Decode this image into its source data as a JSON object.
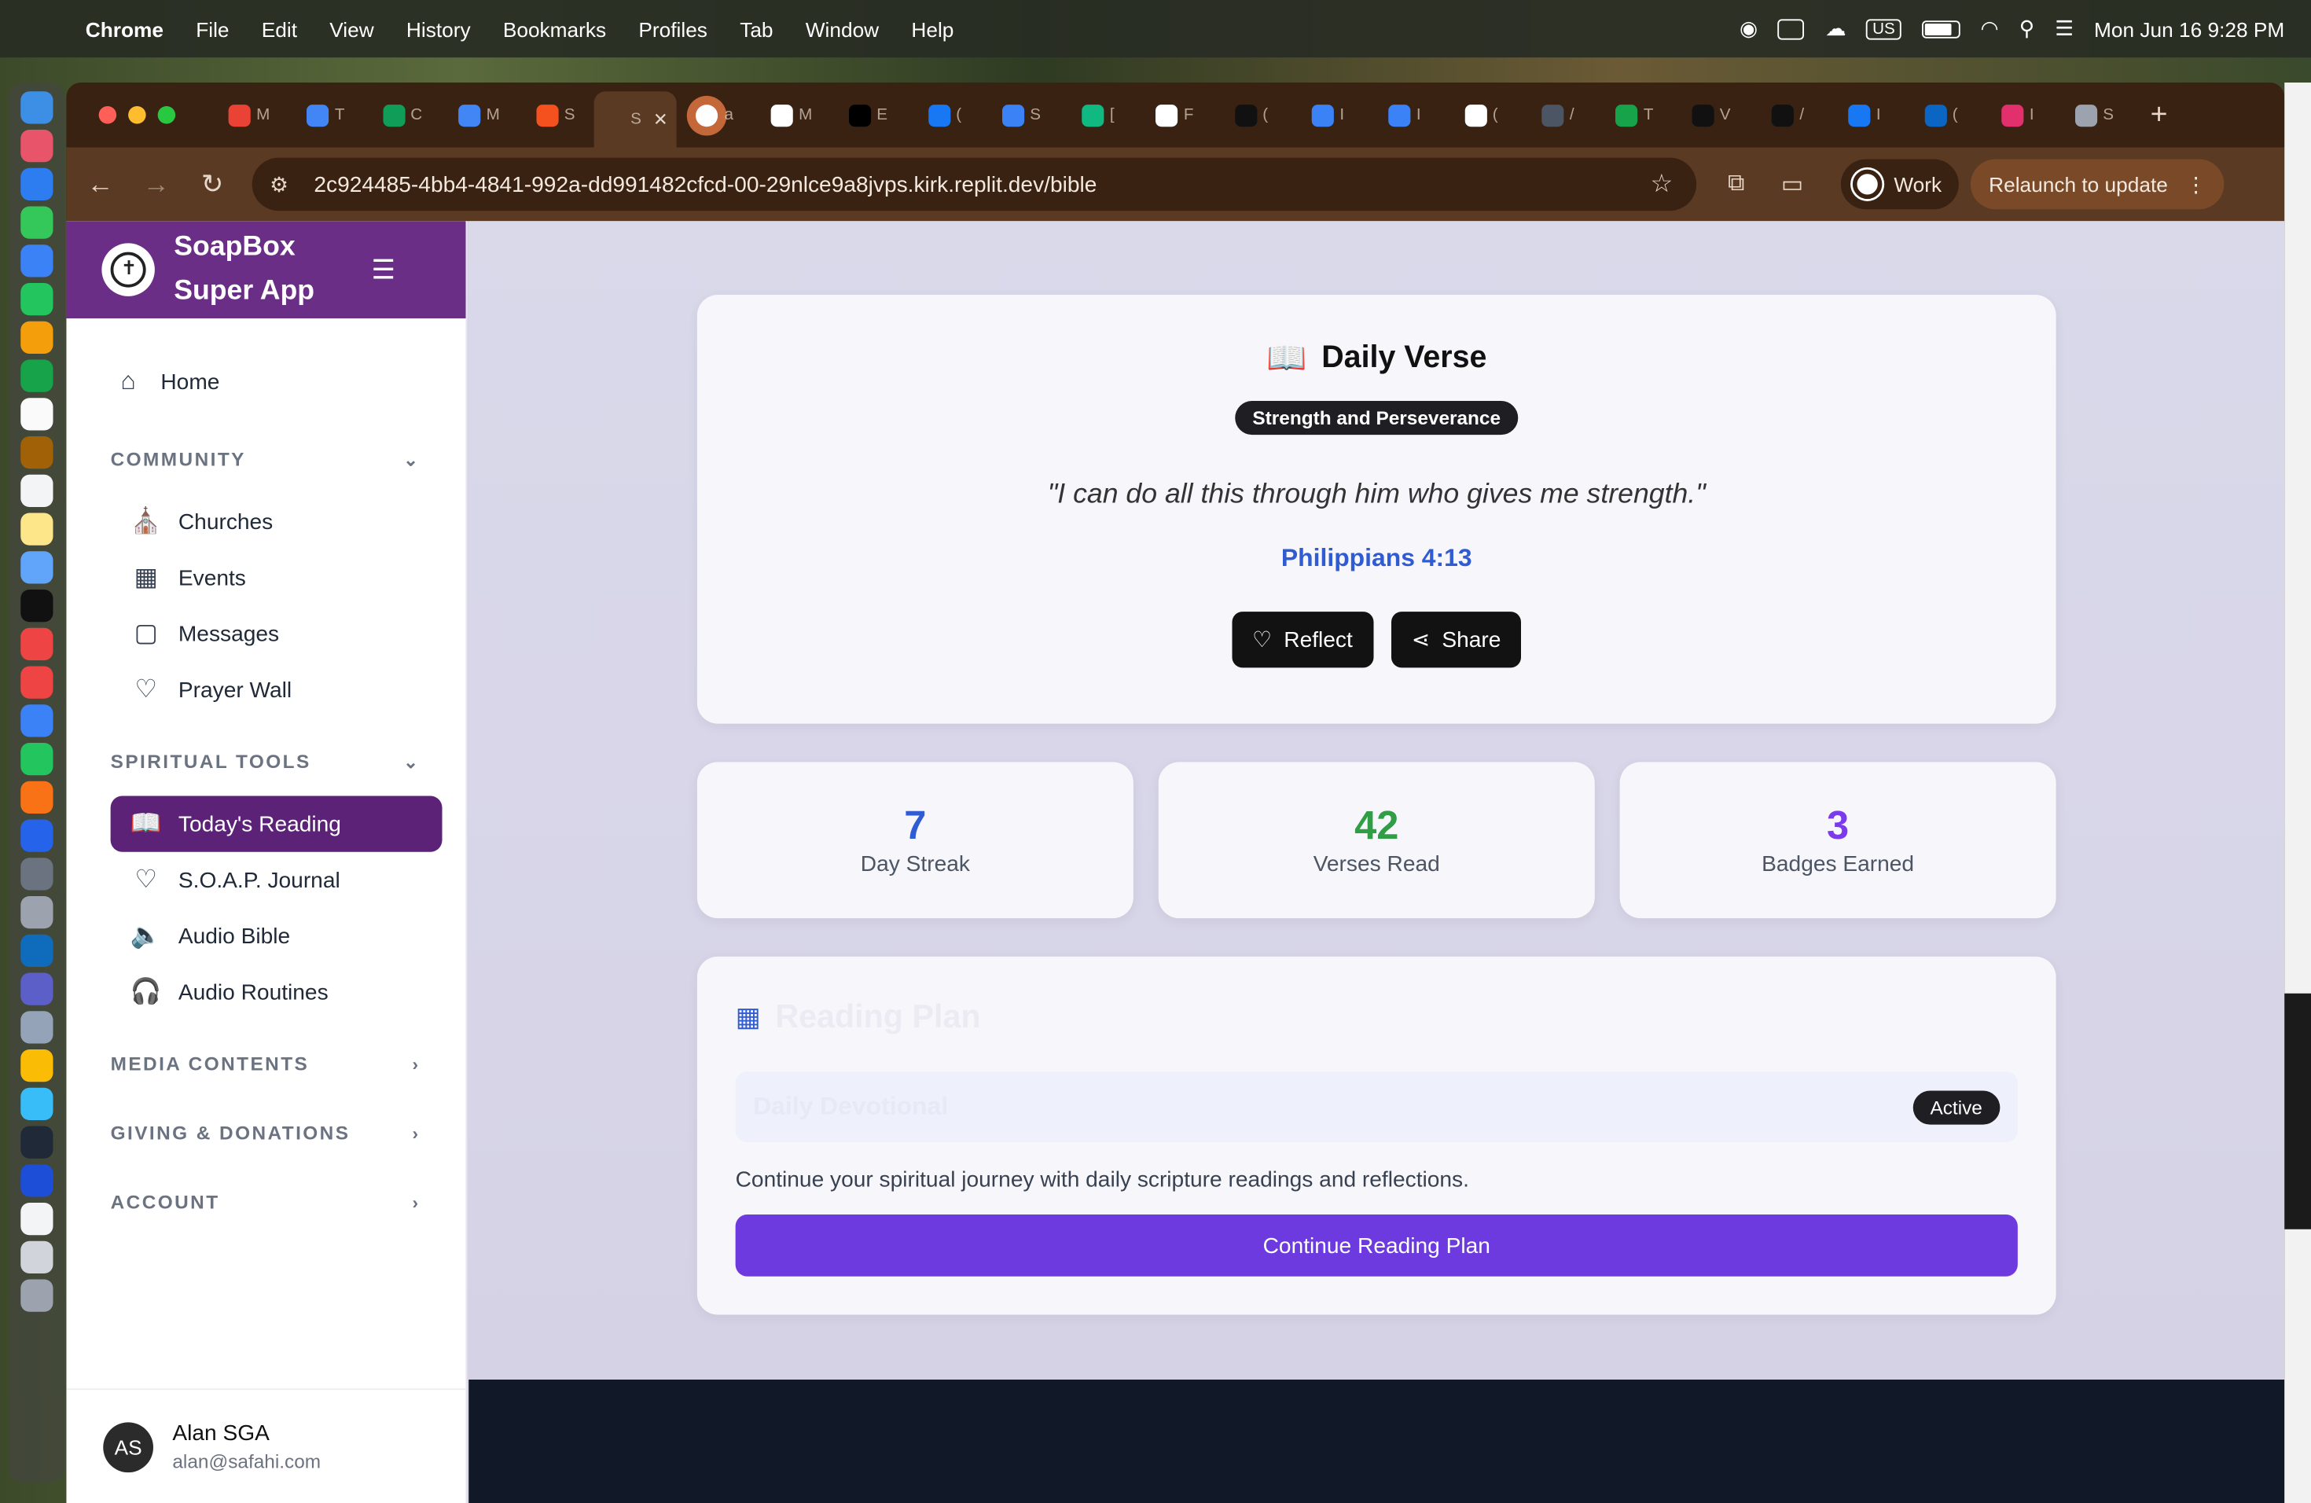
{
  "menubar": {
    "app": "Chrome",
    "items": [
      "File",
      "Edit",
      "View",
      "History",
      "Bookmarks",
      "Profiles",
      "Tab",
      "Window",
      "Help"
    ],
    "keyboard": "US",
    "clock": "Mon Jun 16  9:28 PM"
  },
  "browser": {
    "url": "2c924485-4bb4-4841-992a-dd991482cfcd-00-29nlce9a8jvps.kirk.replit.dev/bible",
    "profile": "Work",
    "relaunch": "Relaunch to update",
    "tabs": [
      {
        "color": "#ea4335",
        "glyph": "M"
      },
      {
        "color": "#4285f4",
        "glyph": "T"
      },
      {
        "color": "#0f9d58",
        "glyph": "C"
      },
      {
        "color": "#4285f4",
        "glyph": "M"
      },
      {
        "color": "#f4511e",
        "glyph": "S"
      },
      {
        "color": "#5a3a23",
        "glyph": "S"
      },
      {
        "color": "#ffffff",
        "glyph": "a"
      },
      {
        "color": "#ffffff",
        "glyph": "M"
      },
      {
        "color": "#000000",
        "glyph": "E"
      },
      {
        "color": "#1877f2",
        "glyph": "("
      },
      {
        "color": "#3b82f6",
        "glyph": "S"
      },
      {
        "color": "#10b981",
        "glyph": "["
      },
      {
        "color": "#ffffff",
        "glyph": "F"
      },
      {
        "color": "#111111",
        "glyph": "("
      },
      {
        "color": "#3b82f6",
        "glyph": "I"
      },
      {
        "color": "#3b82f6",
        "glyph": "I"
      },
      {
        "color": "#ffffff",
        "glyph": "("
      },
      {
        "color": "#4b5563",
        "glyph": "/"
      },
      {
        "color": "#16a34a",
        "glyph": "T"
      },
      {
        "color": "#111111",
        "glyph": "V"
      },
      {
        "color": "#111111",
        "glyph": "/"
      },
      {
        "color": "#1877f2",
        "glyph": "I"
      },
      {
        "color": "#0a66c2",
        "glyph": "("
      },
      {
        "color": "#e1306c",
        "glyph": "I"
      },
      {
        "color": "#9ca3af",
        "glyph": "S"
      }
    ]
  },
  "sidebar": {
    "app_name": "SoapBox Super App",
    "home": "Home",
    "sections": {
      "community": "COMMUNITY",
      "spiritual_tools": "SPIRITUAL TOOLS",
      "media": "MEDIA CONTENTS",
      "giving": "GIVING & DONATIONS",
      "account": "ACCOUNT"
    },
    "community_items": [
      "Churches",
      "Events",
      "Messages",
      "Prayer Wall"
    ],
    "spiritual_items": [
      "Today's Reading",
      "S.O.A.P. Journal",
      "Audio Bible",
      "Audio Routines"
    ],
    "user": {
      "initials": "AS",
      "name": "Alan SGA",
      "email": "alan@safahi.com"
    }
  },
  "daily_verse": {
    "title": "Daily Verse",
    "theme": "Strength and Perseverance",
    "text": "\"I can do all this through him who gives me strength.\"",
    "reference": "Philippians 4:13",
    "reflect": "Reflect",
    "share": "Share"
  },
  "stats": [
    {
      "value": "7",
      "label": "Day Streak",
      "color": "#2f5bd3"
    },
    {
      "value": "42",
      "label": "Verses Read",
      "color": "#2f9e44"
    },
    {
      "value": "3",
      "label": "Badges Earned",
      "color": "#7c3aed"
    }
  ],
  "reading_plan": {
    "title": "Reading Plan",
    "plan_name": "Daily Devotional",
    "status": "Active",
    "description": "Continue your spiritual journey with daily scripture readings and reflections.",
    "button": "Continue Reading Plan"
  }
}
